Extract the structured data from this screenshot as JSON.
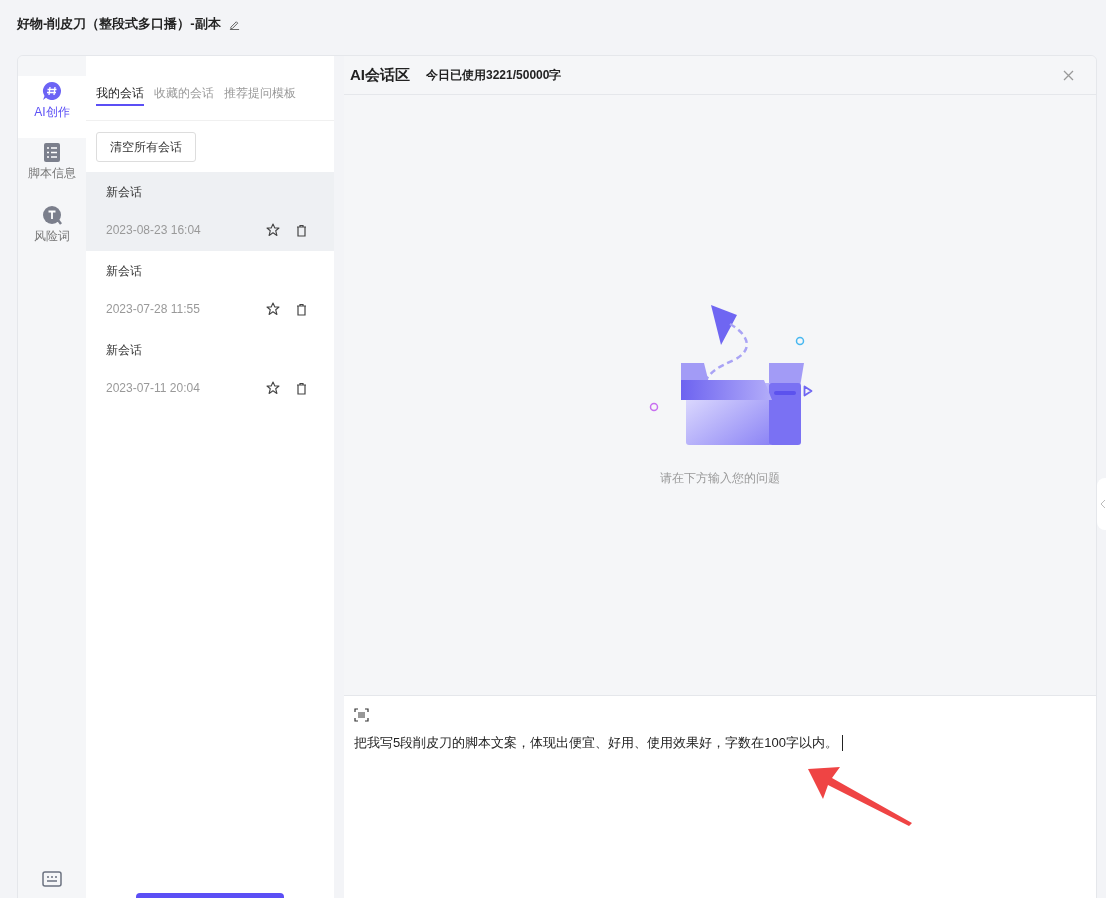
{
  "page_title": "好物-削皮刀（整段式多口播）-副本",
  "rail": [
    {
      "kind": "ai",
      "label": "AI创作",
      "selected": true
    },
    {
      "kind": "script",
      "label": "脚本信息",
      "selected": false
    },
    {
      "kind": "risk",
      "label": "风险词",
      "selected": false
    }
  ],
  "tabs": [
    {
      "label": "我的会话",
      "selected": true
    },
    {
      "label": "收藏的会话",
      "selected": false
    },
    {
      "label": "推荐提问模板",
      "selected": false
    }
  ],
  "clear_button": "清空所有会话",
  "sessions": [
    {
      "title": "新会话",
      "time": "2023-08-23 16:04",
      "selected": true
    },
    {
      "title": "新会话",
      "time": "2023-07-28 11:55",
      "selected": false
    },
    {
      "title": "新会话",
      "time": "2023-07-11 20:04",
      "selected": false
    }
  ],
  "chat": {
    "title": "AI会话区",
    "usage": "今日已使用3221/50000字",
    "empty_hint": "请在下方输入您的问题"
  },
  "input": {
    "value": "把我写5段削皮刀的脚本文案，体现出便宜、好用、使用效果好，字数在100字以内。"
  }
}
